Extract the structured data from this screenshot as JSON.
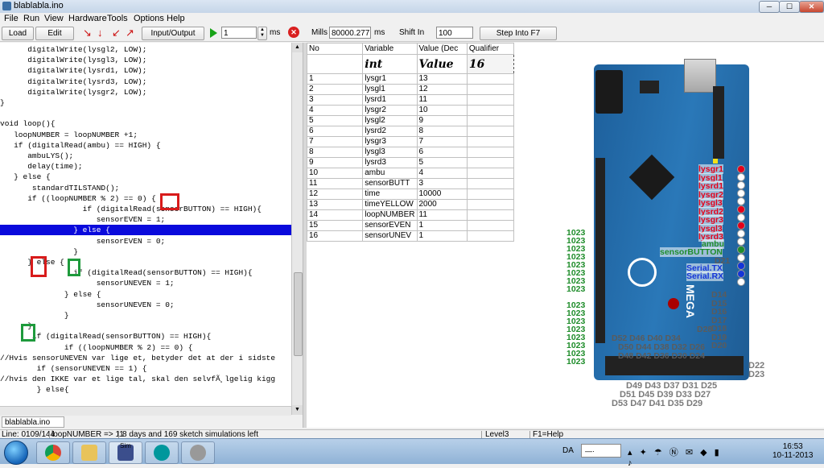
{
  "window": {
    "title": "blablabla.ino",
    "min": "─",
    "max": "☐",
    "close": "✕"
  },
  "menu": [
    "File",
    "Run",
    "View",
    "Hardware",
    "Tools",
    "Options",
    "Help"
  ],
  "toolbar": {
    "load": "Load",
    "edit": "Edit",
    "io": "Input/Output",
    "step_value": "1",
    "ms1": "ms",
    "mills_label": "Mills",
    "mills_value": "80000.277",
    "ms2": "ms",
    "shift_in_label": "Shift In",
    "shift_in_value": "100",
    "step_into": "Step Into F7"
  },
  "code_lines": [
    "      digitalWrite(lysgl2, LOW);",
    "      digitalWrite(lysgl3, LOW);",
    "      digitalWrite(lysrd1, LOW);",
    "      digitalWrite(lysrd3, LOW);",
    "      digitalWrite(lysgr2, LOW);",
    "}",
    "",
    "void loop(){",
    "   loopNUMBER = loopNUMBER +1;",
    "   if (digitalRead(ambu) == HIGH) {",
    "      ambuLYS();",
    "      delay(time);",
    "   } else {",
    "       standardTILSTAND();",
    "      if ((loopNUMBER % 2) == 0) {",
    "                  if (digitalRead(sensorBUTTON) == HIGH){",
    "                     sensorEVEN = 1;",
    "                } else {",
    "                     sensorEVEN = 0;",
    "                }",
    "      } else {",
    "                if (digitalRead(sensorBUTTON) == HIGH){",
    "                     sensorUNEVEN = 1;",
    "              } else {",
    "                     sensorUNEVEN = 0;",
    "              }",
    "      }",
    "       if (digitalRead(sensorBUTTON) == HIGH){",
    "              if ((loopNUMBER % 2) == 0) {",
    "//Hvis sensorUNEVEN var lige et, betyder det at der i sidste",
    "        if (sensorUNEVEN == 1) {",
    "//hvis den IKKE var et lige tal, skal den selvfÃ¸lgelig kigg",
    "        } else{"
  ],
  "file_tab": "blablabla.ino",
  "table": {
    "headers": [
      "No",
      "Variable",
      "Value (Dec",
      "Qualifier"
    ],
    "types": [
      "",
      "int",
      "Value",
      "16"
    ],
    "rows": [
      [
        "1",
        "lysgr1",
        "13"
      ],
      [
        "2",
        "lysgl1",
        "12"
      ],
      [
        "3",
        "lysrd1",
        "11"
      ],
      [
        "4",
        "lysgr2",
        "10"
      ],
      [
        "5",
        "lysgl2",
        "9"
      ],
      [
        "6",
        "lysrd2",
        "8"
      ],
      [
        "7",
        "lysgr3",
        "7"
      ],
      [
        "8",
        "lysgl3",
        "6"
      ],
      [
        "9",
        "lysrd3",
        "5"
      ],
      [
        "10",
        "ambu",
        "4"
      ],
      [
        "11",
        "sensorBUTT",
        "3"
      ],
      [
        "12",
        "time",
        "10000"
      ],
      [
        "13",
        "timeYELLOW",
        "2000"
      ],
      [
        "14",
        "loopNUMBER",
        "11"
      ],
      [
        "15",
        "sensorEVEN",
        "1"
      ],
      [
        "16",
        "sensorUNEV",
        "1"
      ]
    ]
  },
  "board": {
    "top_labels": [
      "lysgr1",
      "lysgl1",
      "lysrd1",
      "lysgr2",
      "lysgl3",
      "lysrd2"
    ],
    "mid_labels": [
      "lysgr3",
      "lysgl3",
      "lysrd3"
    ],
    "ambu": "ambu",
    "sensor": "sensorBUTTON",
    "serial": [
      "Serial.TX",
      "Serial.RX"
    ],
    "d_right": [
      "D14",
      "D15",
      "D16",
      "D17",
      "D18",
      "D19",
      "D20"
    ],
    "d21": "D21",
    "d28": "D28",
    "d_row1": "D52 D46    D40 D34",
    "d_row2": "D50 D44 D38 D32 D26",
    "d_row3": "D48 D42 D36 D30 D24",
    "d22": "D22",
    "d23": "D23",
    "d_bottom1": "D49  D43  D37  D31  D25",
    "d_bottom2": "D51  D45  D39  D33  D27",
    "d_bottom3": "D53  D47  D41  D35  D29",
    "analog_value": "1023",
    "mega": "MEGA"
  },
  "status": {
    "line": "Line: 0109/144",
    "watch": "loopNUMBER => 11",
    "sim": "8 days and 169 sketch simulations left",
    "level": "Level3",
    "help": "F1=Help"
  },
  "taskbar": {
    "lang": "DA",
    "time": "16:53",
    "date": "10-11-2013",
    "sim_label": "Sim"
  }
}
